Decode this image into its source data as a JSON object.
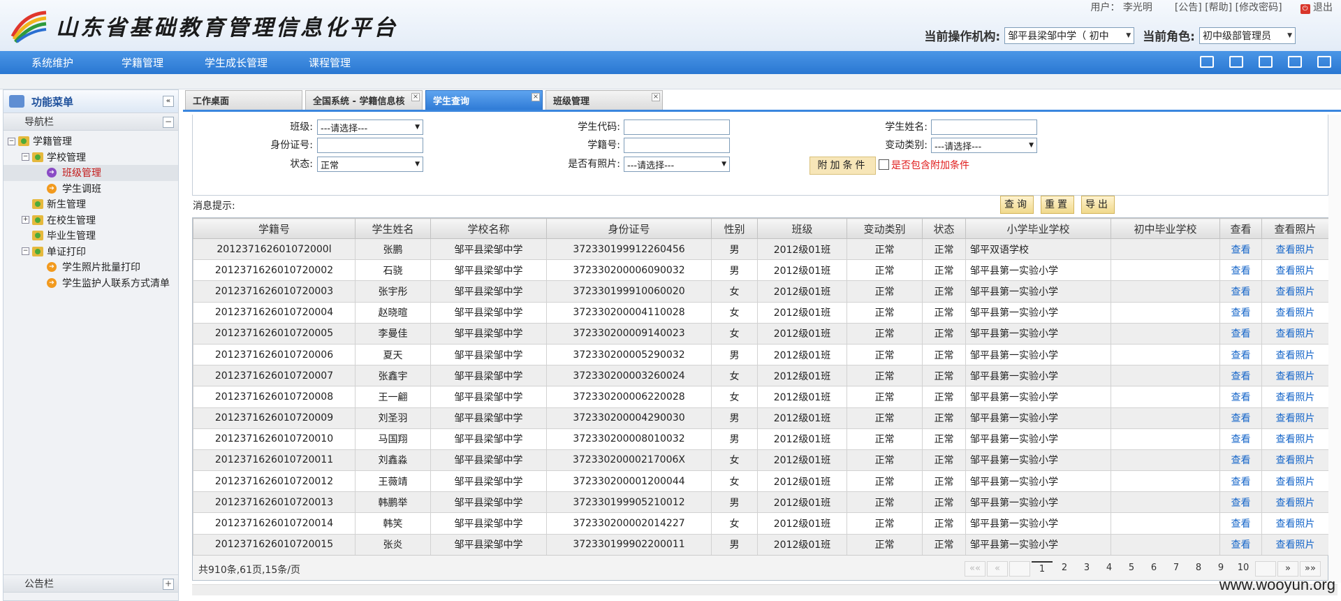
{
  "header": {
    "title": "山东省基础教育管理信息化平台",
    "user_label": "用户：",
    "user_name": "李光明",
    "links": [
      "[公告]",
      "[帮助]",
      "[修改密码]"
    ],
    "exit_label": "退出",
    "org_label": "当前操作机构:",
    "org_value": "邹平县梁邹中学（ 初中",
    "role_label": "当前角色:",
    "role_value": "初中级部管理员"
  },
  "topnav": [
    "系统维护",
    "学籍管理",
    "学生成长管理",
    "课程管理"
  ],
  "sidebar": {
    "title": "功能菜单",
    "nav_section": "导航栏",
    "tree": [
      {
        "label": "学籍管理",
        "level": 0,
        "type": "folder",
        "exp": "-"
      },
      {
        "label": "学校管理",
        "level": 1,
        "type": "folder",
        "exp": "-"
      },
      {
        "label": "班级管理",
        "level": 2,
        "type": "dot-purple",
        "selected": true
      },
      {
        "label": "学生调班",
        "level": 2,
        "type": "dot"
      },
      {
        "label": "新生管理",
        "level": 1,
        "type": "folder"
      },
      {
        "label": "在校生管理",
        "level": 1,
        "type": "folder",
        "exp": "+"
      },
      {
        "label": "毕业生管理",
        "level": 1,
        "type": "folder"
      },
      {
        "label": "单证打印",
        "level": 1,
        "type": "folder",
        "exp": "-"
      },
      {
        "label": "学生照片批量打印",
        "level": 2,
        "type": "dot"
      },
      {
        "label": "学生监护人联系方式清单",
        "level": 2,
        "type": "dot"
      }
    ],
    "notice_section": "公告栏"
  },
  "tabs": [
    {
      "label": "工作桌面",
      "closable": false,
      "active": false
    },
    {
      "label": "全国系统 - 学籍信息核",
      "closable": true,
      "active": false
    },
    {
      "label": "学生查询",
      "closable": true,
      "active": true
    },
    {
      "label": "班级管理",
      "closable": true,
      "active": false
    }
  ],
  "form": {
    "class_label": "班级:",
    "class_value": "---请选择---",
    "student_code_label": "学生代码:",
    "student_code_value": "",
    "student_name_label": "学生姓名:",
    "student_name_value": "",
    "id_label": "身份证号:",
    "id_value": "",
    "roll_label": "学籍号:",
    "roll_value": "",
    "change_label": "变动类别:",
    "change_value": "---请选择---",
    "status_label": "状态:",
    "status_value": "正常",
    "photo_label": "是否有照片:",
    "photo_value": "---请选择---",
    "add_cond_label": "附加条件",
    "include_cond_label": "是否包含附加条件"
  },
  "message_label": "消息提示:",
  "actions": [
    "查询",
    "重置",
    "导出"
  ],
  "table": {
    "columns": [
      "学籍号",
      "学生姓名",
      "学校名称",
      "身份证号",
      "性别",
      "班级",
      "变动类别",
      "状态",
      "小学毕业学校",
      "初中毕业学校",
      "查看",
      "查看照片"
    ],
    "rows": [
      [
        "201237162601072000l",
        "张鹏",
        "邹平县梁邹中学",
        "372330199912260456",
        "男",
        "2012级01班",
        "正常",
        "正常",
        "邹平双语学校",
        "",
        "查看",
        "查看照片"
      ],
      [
        "2012371626010720002",
        "石骁",
        "邹平县梁邹中学",
        "372330200006090032",
        "男",
        "2012级01班",
        "正常",
        "正常",
        "邹平县第一实验小学",
        "",
        "查看",
        "查看照片"
      ],
      [
        "2012371626010720003",
        "张宇彤",
        "邹平县梁邹中学",
        "372330199910060020",
        "女",
        "2012级01班",
        "正常",
        "正常",
        "邹平县第一实验小学",
        "",
        "查看",
        "查看照片"
      ],
      [
        "2012371626010720004",
        "赵晓暄",
        "邹平县梁邹中学",
        "372330200004110028",
        "女",
        "2012级01班",
        "正常",
        "正常",
        "邹平县第一实验小学",
        "",
        "查看",
        "查看照片"
      ],
      [
        "2012371626010720005",
        "李曼佳",
        "邹平县梁邹中学",
        "372330200009140023",
        "女",
        "2012级01班",
        "正常",
        "正常",
        "邹平县第一实验小学",
        "",
        "查看",
        "查看照片"
      ],
      [
        "2012371626010720006",
        "夏天",
        "邹平县梁邹中学",
        "372330200005290032",
        "男",
        "2012级01班",
        "正常",
        "正常",
        "邹平县第一实验小学",
        "",
        "查看",
        "查看照片"
      ],
      [
        "2012371626010720007",
        "张鑫宇",
        "邹平县梁邹中学",
        "372330200003260024",
        "女",
        "2012级01班",
        "正常",
        "正常",
        "邹平县第一实验小学",
        "",
        "查看",
        "查看照片"
      ],
      [
        "2012371626010720008",
        "王一翩",
        "邹平县梁邹中学",
        "372330200006220028",
        "女",
        "2012级01班",
        "正常",
        "正常",
        "邹平县第一实验小学",
        "",
        "查看",
        "查看照片"
      ],
      [
        "2012371626010720009",
        "刘圣羽",
        "邹平县梁邹中学",
        "372330200004290030",
        "男",
        "2012级01班",
        "正常",
        "正常",
        "邹平县第一实验小学",
        "",
        "查看",
        "查看照片"
      ],
      [
        "2012371626010720010",
        "马国翔",
        "邹平县梁邹中学",
        "372330200008010032",
        "男",
        "2012级01班",
        "正常",
        "正常",
        "邹平县第一实验小学",
        "",
        "查看",
        "查看照片"
      ],
      [
        "2012371626010720011",
        "刘鑫淼",
        "邹平县梁邹中学",
        "37233020000217006X",
        "女",
        "2012级01班",
        "正常",
        "正常",
        "邹平县第一实验小学",
        "",
        "查看",
        "查看照片"
      ],
      [
        "2012371626010720012",
        "王薇靖",
        "邹平县梁邹中学",
        "372330200001200044",
        "女",
        "2012级01班",
        "正常",
        "正常",
        "邹平县第一实验小学",
        "",
        "查看",
        "查看照片"
      ],
      [
        "2012371626010720013",
        "韩鹏举",
        "邹平县梁邹中学",
        "372330199905210012",
        "男",
        "2012级01班",
        "正常",
        "正常",
        "邹平县第一实验小学",
        "",
        "查看",
        "查看照片"
      ],
      [
        "2012371626010720014",
        "韩笑",
        "邹平县梁邹中学",
        "372330200002014227",
        "女",
        "2012级01班",
        "正常",
        "正常",
        "邹平县第一实验小学",
        "",
        "查看",
        "查看照片"
      ],
      [
        "2012371626010720015",
        "张炎",
        "邹平县梁邹中学",
        "372330199902200011",
        "男",
        "2012级01班",
        "正常",
        "正常",
        "邹平县第一实验小学",
        "",
        "查看",
        "查看照片"
      ]
    ]
  },
  "pager": {
    "info": "共910条,61页,15条/页",
    "first": "««",
    "prev": "«",
    "pages": [
      "1",
      "2",
      "3",
      "4",
      "5",
      "6",
      "7",
      "8",
      "9",
      "10"
    ],
    "current": "1",
    "next": "»",
    "last": "»»"
  },
  "watermark": "www.wooyun.org"
}
